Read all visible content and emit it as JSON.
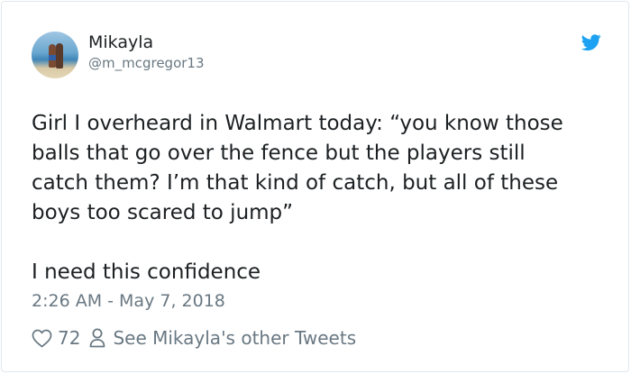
{
  "author": {
    "name": "Mikayla",
    "handle": "@m_mcgregor13"
  },
  "icons": {
    "avatar": "profile-photo",
    "brand": "twitter-bird-icon",
    "like": "heart-icon",
    "profile": "person-icon"
  },
  "tweet": {
    "text_paragraph_1": "Girl I overheard in Walmart today: “you know those\nballs that go over the fence but the players still\ncatch them? I’m that kind of catch, but all of these\nboys too scared to jump”",
    "text_paragraph_2": "I need this confidence",
    "timestamp": "2:26 AM - May 7, 2018"
  },
  "actions": {
    "like_count": "72",
    "see_more_label": "See Mikayla's other Tweets"
  },
  "colors": {
    "brand_blue": "#1da1f2",
    "text_primary": "#1c2022",
    "text_secondary": "#697882",
    "border": "#e1e8ed"
  }
}
